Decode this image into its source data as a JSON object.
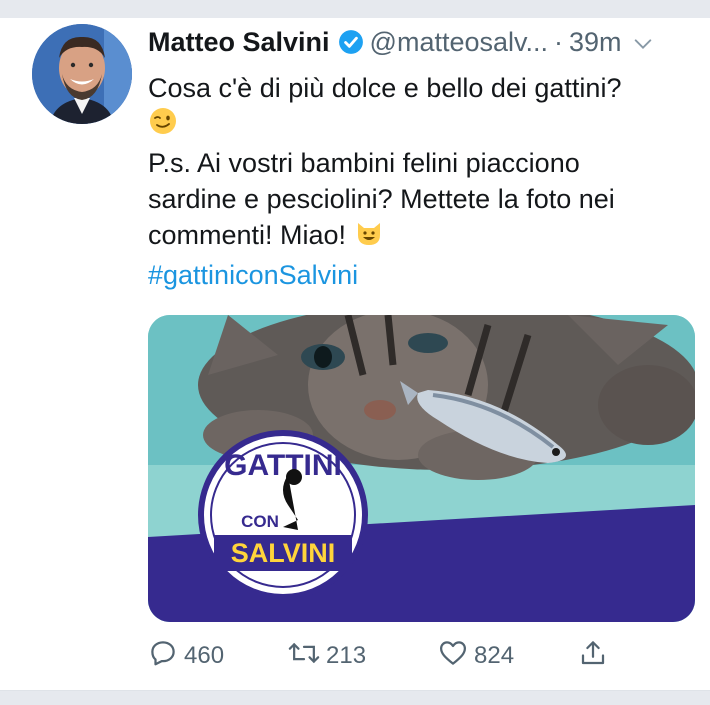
{
  "tweet": {
    "author_name": "Matteo Salvini",
    "author_handle": "@matteosalv...",
    "separator": "·",
    "time": "39m",
    "text_line_1": "Cosa c'è di più dolce e bello dei gattini?",
    "text_line_2": "P.s. Ai vostri bambini felini piacciono",
    "text_line_3": "sardine e pesciolini? Mettete la foto nei",
    "text_line_4": "commenti! Miao!",
    "hashtag": "#gattiniconSalvini"
  },
  "media": {
    "logo_top_text": "GATTINI",
    "logo_middle_text": "CON",
    "logo_bottom_text": "SALVINI"
  },
  "actions": {
    "reply_count": "460",
    "retweet_count": "213",
    "like_count": "824"
  },
  "icons": {
    "verified": "verified-badge-icon",
    "menu": "chevron-down-icon",
    "wink": "winking-face-emoji",
    "cat": "smiling-cat-emoji",
    "reply": "reply-icon",
    "retweet": "retweet-icon",
    "like": "heart-icon",
    "share": "share-icon"
  },
  "colors": {
    "link": "#1b95e0",
    "muted": "#536471",
    "text": "#14171a",
    "media_teal": "#6fc4c6",
    "media_navy": "#362a8f"
  }
}
